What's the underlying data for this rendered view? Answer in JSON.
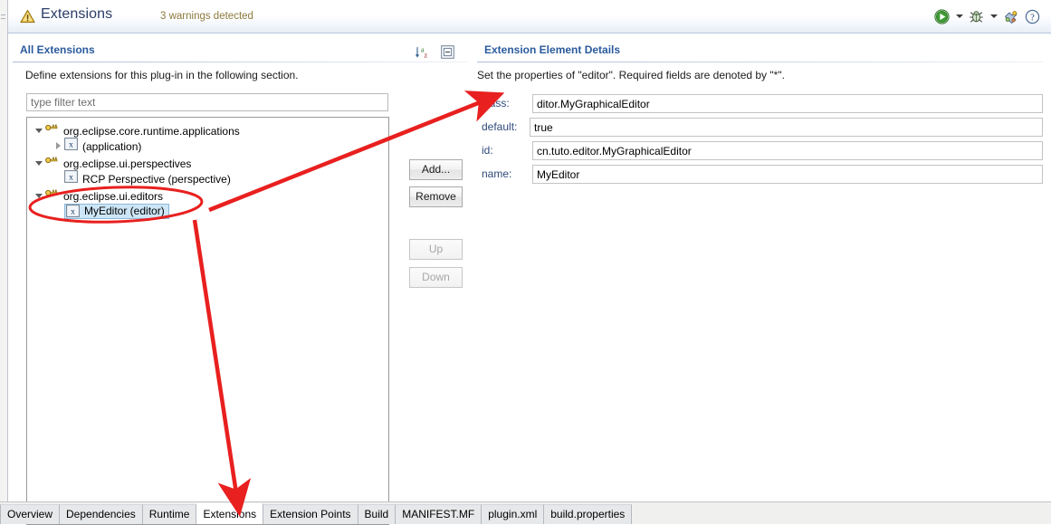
{
  "header": {
    "title": "Extensions",
    "warnings": "3 warnings detected",
    "warning_icon": "warning-triangle-icon",
    "tools": [
      {
        "name": "run-icon",
        "label": "Run"
      },
      {
        "name": "run-dropdown-arrow-icon",
        "label": ""
      },
      {
        "name": "debug-bug-icon",
        "label": "Debug"
      },
      {
        "name": "debug-dropdown-arrow-icon",
        "label": ""
      },
      {
        "name": "plugin-puzzle-icon",
        "label": "Plug-in"
      },
      {
        "name": "help-question-icon",
        "label": "Help"
      }
    ]
  },
  "left_section": {
    "title": "All Extensions",
    "description": "Define extensions for this plug-in in the following section.",
    "sort_icon": "sort-az-icon",
    "collapse_icon": "collapse-all-icon",
    "filter_placeholder": "type filter text",
    "filter_value": "",
    "tree": [
      {
        "label": "org.eclipse.core.runtime.applications",
        "icon": "extension-point-icon",
        "twisty": "open",
        "depth": 0,
        "selected": false
      },
      {
        "label": "(application)",
        "icon": "xml-element-icon",
        "twisty": "closed",
        "depth": 1,
        "selected": false
      },
      {
        "label": "org.eclipse.ui.perspectives",
        "icon": "extension-point-icon",
        "twisty": "open",
        "depth": 0,
        "selected": false
      },
      {
        "label": "RCP Perspective (perspective)",
        "icon": "xml-element-icon",
        "twisty": "none",
        "depth": 1,
        "selected": false
      },
      {
        "label": "org.eclipse.ui.editors",
        "icon": "extension-point-icon",
        "twisty": "open",
        "depth": 0,
        "selected": false
      },
      {
        "label": "MyEditor (editor)",
        "icon": "xml-element-icon",
        "twisty": "none",
        "depth": 1,
        "selected": true
      }
    ],
    "buttons": [
      {
        "label": "Add...",
        "enabled": true
      },
      {
        "label": "Remove",
        "enabled": true
      },
      {
        "label": "Up",
        "enabled": false
      },
      {
        "label": "Down",
        "enabled": false
      }
    ]
  },
  "right_section": {
    "title": "Extension Element Details",
    "description": "Set the properties of \"editor\". Required fields are denoted by \"*\".",
    "fields": [
      {
        "label": "class:",
        "value": "ditor.MyGraphicalEditor"
      },
      {
        "label": "default:",
        "value": "true"
      },
      {
        "label": "id:",
        "value": "cn.tuto.editor.MyGraphicalEditor"
      },
      {
        "label": "name:",
        "value": "MyEditor"
      }
    ]
  },
  "tabs": [
    {
      "label": "Overview",
      "active": false
    },
    {
      "label": "Dependencies",
      "active": false
    },
    {
      "label": "Runtime",
      "active": false
    },
    {
      "label": "Extensions",
      "active": true
    },
    {
      "label": "Extension Points",
      "active": false
    },
    {
      "label": "Build",
      "active": false
    },
    {
      "label": "MANIFEST.MF",
      "active": false
    },
    {
      "label": "plugin.xml",
      "active": false
    },
    {
      "label": "build.properties",
      "active": false
    }
  ],
  "annotations": {
    "highlight_color": "#e8201f",
    "ellipse": {
      "label": "highlight-ellipse-myeditor"
    },
    "arrow_to_class": {
      "label": "arrow-to-class-field"
    },
    "arrow_to_tab": {
      "label": "arrow-to-extensions-tab"
    }
  }
}
